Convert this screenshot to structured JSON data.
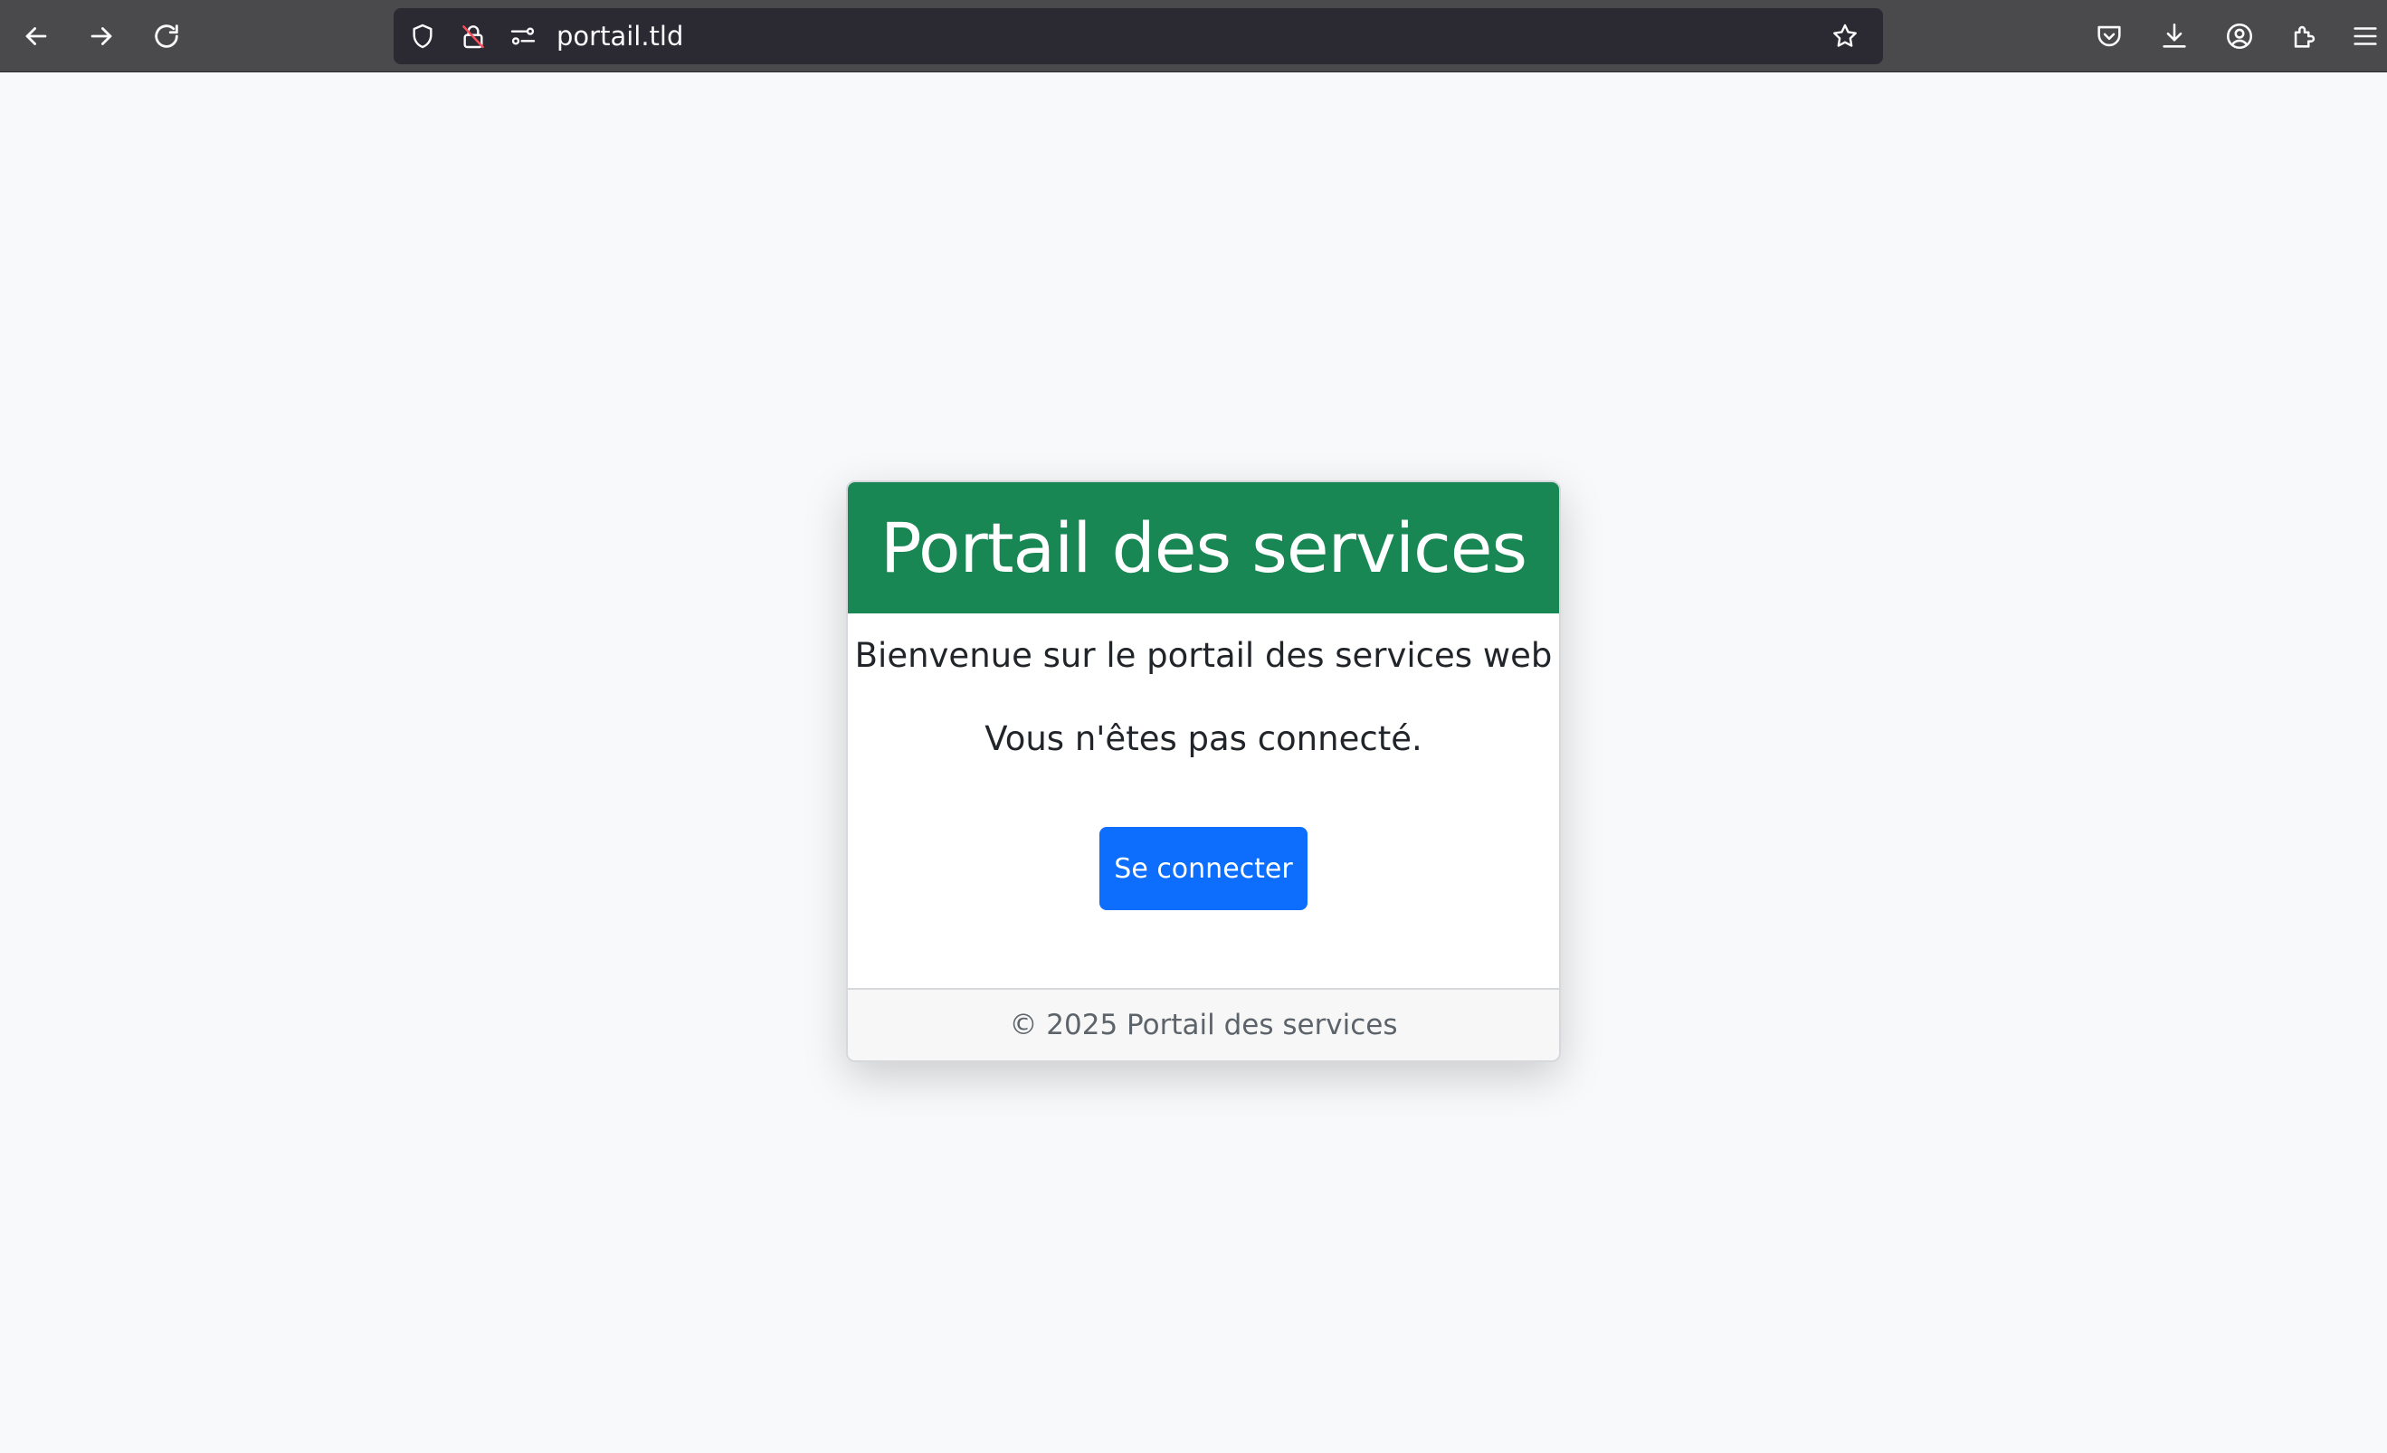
{
  "browser": {
    "url": "portail.tld",
    "icons": {
      "back": "arrow-left-icon",
      "forward": "arrow-right-icon",
      "reload": "reload-icon",
      "tracking": "shield-icon",
      "insecure": "insecure-lock-icon",
      "permissions": "permissions-icon",
      "bookmark": "star-icon",
      "pocket": "pocket-icon",
      "downloads": "download-icon",
      "account": "account-icon",
      "extensions": "extensions-icon",
      "menu": "hamburger-menu-icon"
    }
  },
  "page": {
    "header_title": "Portail des services",
    "welcome_text": "Bienvenue sur le portail des services web",
    "status_text": "Vous n'êtes pas connecté.",
    "login_button": "Se connecter",
    "footer_text": "© 2025 Portail des services"
  },
  "colors": {
    "header_bg": "#198754",
    "button_bg": "#0d6efd",
    "page_bg": "#f8f9fa",
    "toolbar_bg": "#4a4a4c",
    "urlbar_bg": "#2b2a33"
  }
}
